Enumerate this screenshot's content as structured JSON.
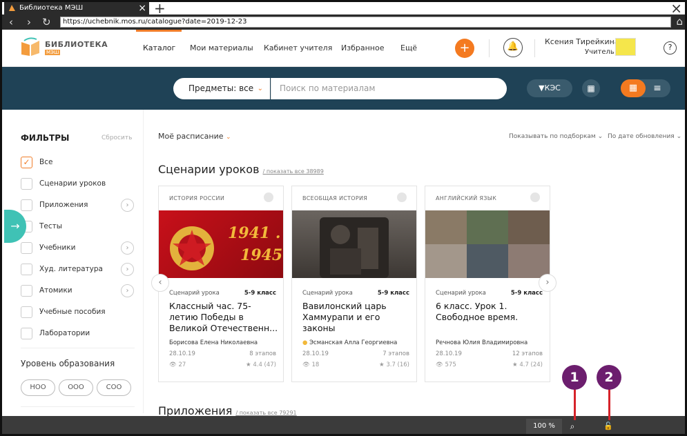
{
  "browser": {
    "tab_title": "Библиотека МЭШ",
    "url": "https://uchebnik.mos.ru/catalogue?date=2019-12-23"
  },
  "header": {
    "logo_text": "БИБЛИОТЕКА",
    "logo_sub": "МЭШ",
    "nav": [
      "Каталог",
      "Мои материалы",
      "Кабинет учителя",
      "Избранное",
      "Ещё"
    ],
    "user_name": "Ксения Тирейкина",
    "user_role": "Учитель",
    "help": "?",
    "add": "+"
  },
  "search": {
    "subjects_label": "Предметы: все",
    "placeholder": "Поиск по материалам",
    "kes_label": "КЭС"
  },
  "sidebar": {
    "title": "ФИЛЬТРЫ",
    "reset": "Сбросить",
    "filters": [
      {
        "label": "Все",
        "checked": true
      },
      {
        "label": "Сценарии уроков",
        "checked": false
      },
      {
        "label": "Приложения",
        "checked": false
      },
      {
        "label": "Тесты",
        "checked": false
      },
      {
        "label": "Учебники",
        "checked": false
      },
      {
        "label": "Худ. литература",
        "checked": false
      },
      {
        "label": "Атомики",
        "checked": false
      },
      {
        "label": "Учебные пособия",
        "checked": false
      },
      {
        "label": "Лаборатории",
        "checked": false
      }
    ],
    "edu_title": "Уровень образования",
    "edu_levels": [
      "НОО",
      "ООО",
      "СОО"
    ]
  },
  "main": {
    "schedule": "Моё расписание",
    "sort_group": "Показывать по подборкам",
    "sort_date": "По дате обновления",
    "section1_title": "Сценарии уроков",
    "section1_link": "показать все 38989",
    "section2_title": "Приложения",
    "section2_link": "показать все 79291",
    "cards": [
      {
        "subject": "ИСТОРИЯ РОССИИ",
        "type": "Сценарий урока",
        "grade": "5-9 класс",
        "title": "Классный час. 75-летию Победы в Великой Отечественн...",
        "author": "Борисова Елена Николаевна",
        "date": "28.10.19",
        "stages": "8 этапов",
        "views": "27",
        "rating": "4.4 (47)"
      },
      {
        "subject": "ВСЕОБЩАЯ ИСТОРИЯ",
        "type": "Сценарий урока",
        "grade": "5-9 класс",
        "title": "Вавилонский царь Хаммурапи и его законы",
        "author": "Эсманская Алла Георгиевна",
        "date": "28.10.19",
        "stages": "7 этапов",
        "views": "18",
        "rating": "3.7 (16)"
      },
      {
        "subject": "АНГЛИЙСКИЙ ЯЗЫК",
        "type": "Сценарий урока",
        "grade": "5-9 класс",
        "title": "6 класс. Урок 1. Свободное время.",
        "author": "Речнова Юлия Владимировна",
        "date": "28.10.19",
        "stages": "12 этапов",
        "views": "575",
        "rating": "4.7 (24)"
      }
    ],
    "card1_image_text": [
      "1941 .",
      "1945"
    ]
  },
  "bottom": {
    "zoom": "100 %"
  },
  "callouts": [
    "1",
    "2"
  ],
  "colors": {
    "accent": "#f47a20",
    "band": "#1f4256",
    "teal": "#3fc2b5",
    "callout": "#6c1e6e",
    "callout_line": "#d6232a"
  }
}
